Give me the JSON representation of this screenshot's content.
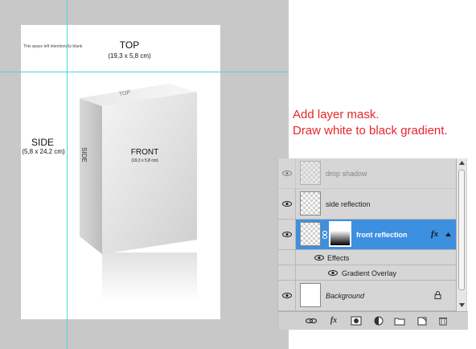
{
  "artwork": {
    "tiny_text": "This space left intentionally blank",
    "top_label": "TOP",
    "top_dims": "(19,3 x 5,8 cm)",
    "side_label": "SIDE",
    "side_dims": "(5,8 x 24,2 cm)",
    "front_label": "FRONT",
    "front_dims": "(19,3 x 5,8 cm)",
    "box_side_text": "SIDE",
    "box_top_text": "TOP"
  },
  "instruction": {
    "line1": "Add layer mask.",
    "line2": "Draw white to black gradient."
  },
  "layers_panel": {
    "layers": [
      {
        "name": "drop shadow",
        "visible": true,
        "faded": true
      },
      {
        "name": "side reflection",
        "visible": true
      },
      {
        "name": "front reflection",
        "visible": true,
        "selected": true,
        "fx": "fx"
      },
      {
        "name": "Effects"
      },
      {
        "name": "Gradient Overlay"
      },
      {
        "name": "Background",
        "visible": true,
        "locked": true
      }
    ],
    "toolbar": [
      "link-icon",
      "fx-icon",
      "mask-icon",
      "adjustment-icon",
      "folder-icon",
      "new-layer-icon",
      "trash-icon"
    ],
    "fx_label": "fx"
  },
  "colors": {
    "instruction": "#e8262b",
    "selection": "#3d8fe0",
    "guide": "#4fd4e8",
    "workspace": "#c8c8c8"
  }
}
